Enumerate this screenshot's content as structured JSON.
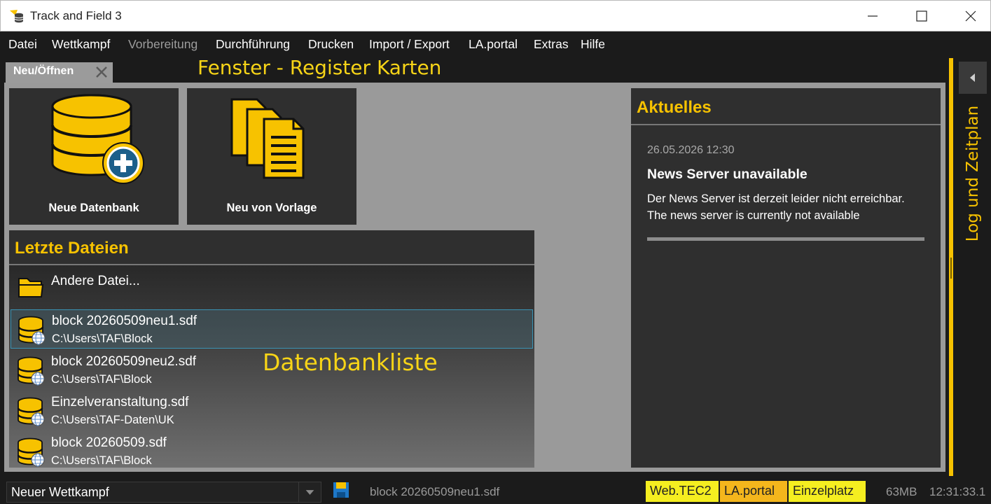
{
  "window": {
    "title": "Track and Field 3"
  },
  "menu": {
    "items": [
      {
        "label": "Datei",
        "enabled": true
      },
      {
        "label": "Wettkampf",
        "enabled": true
      },
      {
        "label": "Vorbereitung",
        "enabled": false
      },
      {
        "label": "Durchführung",
        "enabled": true
      },
      {
        "label": "Drucken",
        "enabled": true
      },
      {
        "label": "Import / Export",
        "enabled": true
      },
      {
        "label": "LA.portal",
        "enabled": true
      },
      {
        "label": "Extras",
        "enabled": true
      },
      {
        "label": "Hilfe",
        "enabled": true
      }
    ]
  },
  "tabs": [
    {
      "label": "Neu/Öffnen",
      "active": true
    }
  ],
  "annotations": {
    "tabs": "Fenster - Register Karten",
    "list": "Datenbankliste"
  },
  "tiles": {
    "new_database": "Neue Datenbank",
    "from_template": "Neu von Vorlage"
  },
  "recent": {
    "title": "Letzte Dateien",
    "other_file": "Andere Datei...",
    "files": [
      {
        "name": "block 20260509neu1.sdf",
        "path": "C:\\Users\\TAF\\Block",
        "selected": true
      },
      {
        "name": "block 20260509neu2.sdf",
        "path": "C:\\Users\\TAF\\Block",
        "selected": false
      },
      {
        "name": "Einzelveranstaltung.sdf",
        "path": "C:\\Users\\TAF-Daten\\UK",
        "selected": false
      },
      {
        "name": "block 20260509.sdf",
        "path": "C:\\Users\\TAF\\Block",
        "selected": false
      }
    ]
  },
  "news": {
    "title": "Aktuelles",
    "date": "26.05.2026 12:30",
    "headline": "News Server unavailable",
    "body_de": "Der News Server ist derzeit leider nicht erreichbar.",
    "body_en": "The news server is currently not available"
  },
  "side_panel": {
    "label": "Log und Zeitplan"
  },
  "status": {
    "competition": "Neuer Wettkampf",
    "file": "block 20260509neu1.sdf",
    "badges": {
      "webtec": "Web.TEC2",
      "laportal": "LA.portal",
      "einzelplatz": "Einzelplatz"
    },
    "memory": "63MB",
    "time": "12:31:33.1"
  },
  "colors": {
    "accent": "#f7c200",
    "background": "#1b1b1b",
    "panel": "#2f2f2f",
    "workarea": "#9a9a9a",
    "selection_border": "#3a93b5",
    "badge_yellow": "#f5ee20",
    "badge_orange": "#f4b61c"
  }
}
